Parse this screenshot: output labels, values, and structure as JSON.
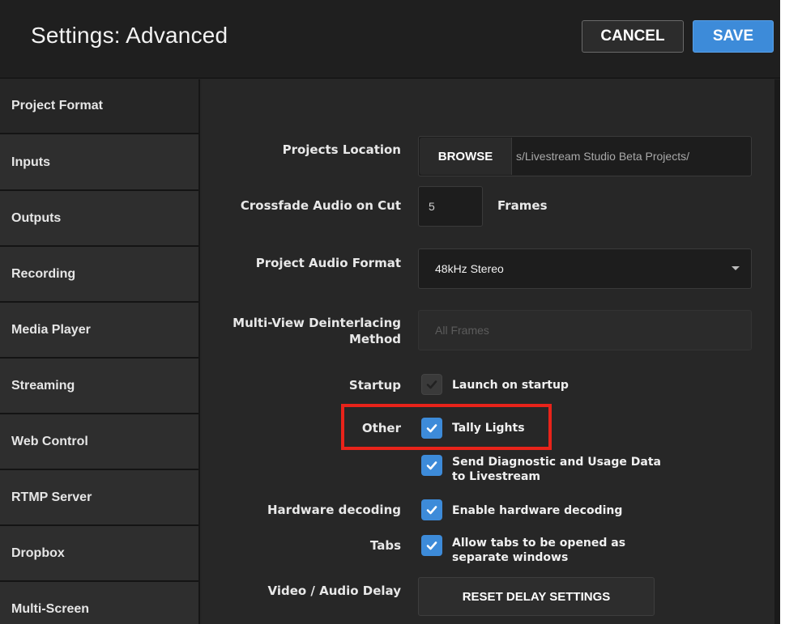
{
  "header": {
    "title": "Settings: Advanced",
    "cancel_label": "CANCEL",
    "save_label": "SAVE"
  },
  "sidebar": {
    "items": [
      {
        "label": "Project Format"
      },
      {
        "label": "Inputs"
      },
      {
        "label": "Outputs"
      },
      {
        "label": "Recording"
      },
      {
        "label": "Media Player"
      },
      {
        "label": "Streaming"
      },
      {
        "label": "Web Control"
      },
      {
        "label": "RTMP Server"
      },
      {
        "label": "Dropbox"
      },
      {
        "label": "Multi-Screen"
      }
    ]
  },
  "settings": {
    "projects_location": {
      "label": "Projects Location",
      "browse_label": "BROWSE",
      "path": "s/Livestream Studio Beta Projects/"
    },
    "crossfade": {
      "label": "Crossfade Audio on Cut",
      "value": "5",
      "unit": "Frames"
    },
    "audio_format": {
      "label": "Project Audio Format",
      "value": "48kHz Stereo"
    },
    "deinterlacing": {
      "label_line1": "Multi-View Deinterlacing",
      "label_line2": "Method",
      "value": "All Frames"
    },
    "startup": {
      "label": "Startup",
      "option": "Launch on startup",
      "checked": true,
      "disabled": true
    },
    "other": {
      "label": "Other",
      "tally": {
        "option": "Tally Lights",
        "checked": true
      },
      "diagnostic": {
        "option_line1": "Send Diagnostic and Usage Data",
        "option_line2": "to Livestream",
        "checked": true
      }
    },
    "hardware_decoding": {
      "label": "Hardware decoding",
      "option": "Enable hardware decoding",
      "checked": true
    },
    "tabs": {
      "label": "Tabs",
      "option_line1": "Allow tabs to be opened as",
      "option_line2": "separate windows",
      "checked": true
    },
    "delay": {
      "label": "Video / Audio Delay",
      "button_label": "RESET DELAY SETTINGS"
    }
  },
  "colors": {
    "accent": "#3d8bd9",
    "highlight": "#e8231a",
    "background": "#262626"
  }
}
